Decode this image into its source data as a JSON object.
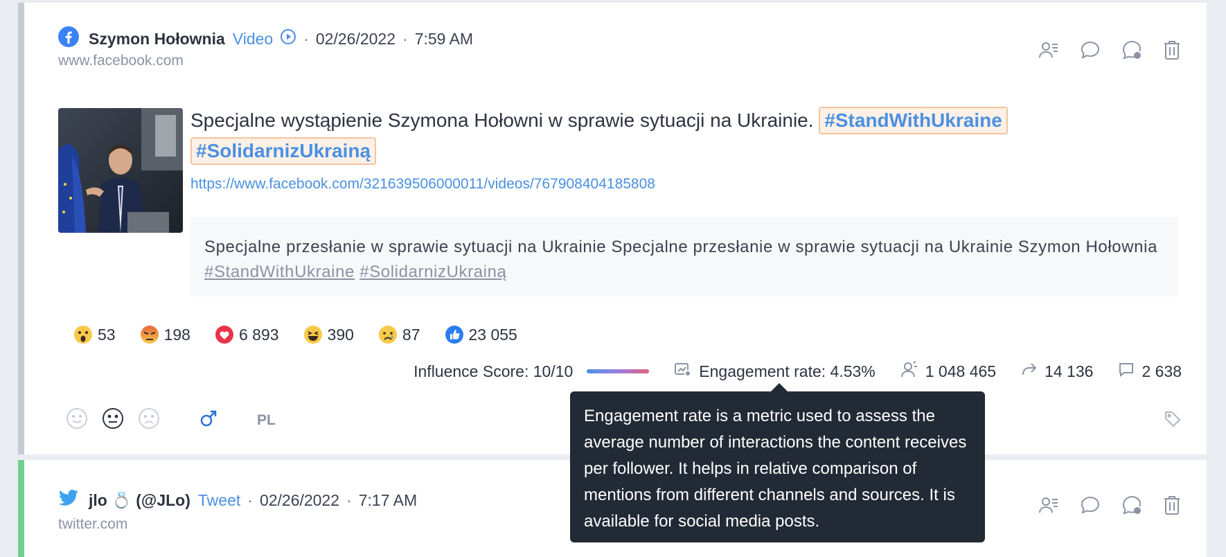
{
  "post1": {
    "author": "Szymon Hołownia",
    "type": "Video",
    "date": "02/26/2022",
    "time": "7:59 AM",
    "domain": "www.facebook.com",
    "title_text": "Specjalne wystąpienie Szymona Hołowni w sprawie sytuacji na Ukrainie.",
    "tags": [
      "#StandWithUkraine",
      "#SolidarnizUkrainą"
    ],
    "url": "https://www.facebook.com/321639506000011/videos/767908404185808",
    "snippet_text": "Specjalne przesłanie w sprawie sytuacji na Ukrainie Specjalne przesłanie w sprawie sytuacji na Ukrainie Szymon Hołownia",
    "snippet_tags": [
      "#StandWithUkraine",
      "#SolidarnizUkrainą"
    ],
    "reactions": [
      {
        "icon": "wow-reaction-icon",
        "count": "53"
      },
      {
        "icon": "angry-reaction-icon",
        "count": "198"
      },
      {
        "icon": "love-reaction-icon",
        "count": "6 893"
      },
      {
        "icon": "haha-reaction-icon",
        "count": "390"
      },
      {
        "icon": "sad-reaction-icon",
        "count": "87"
      },
      {
        "icon": "like-reaction-icon",
        "count": "23 055"
      }
    ],
    "influence_label": "Influence Score: 10/10",
    "engagement_label": "Engagement rate: 4.53%",
    "reach": "1 048 465",
    "shares": "14 136",
    "comments": "2 638",
    "language": "PL"
  },
  "post2": {
    "author": "jlo 💍 (@JLo)",
    "type": "Tweet",
    "date": "02/26/2022",
    "time": "7:17 AM",
    "domain": "twitter.com"
  },
  "tooltip": {
    "text": "Engagement rate is a metric used to assess the average number of interactions the content receives per follower. It helps in relative comparison of mentions from different channels and sources. It is available for social media posts."
  },
  "colors": {
    "accent": "#4a90e2",
    "card1_border": "#c5cad5",
    "card2_border": "#6cd08f",
    "tooltip_bg": "#222a35"
  },
  "icons": [
    "facebook-icon",
    "play-circle-icon",
    "assign-user-icon",
    "comment-icon",
    "reply-icon",
    "trash-icon",
    "twitter-icon",
    "tag-icon"
  ]
}
